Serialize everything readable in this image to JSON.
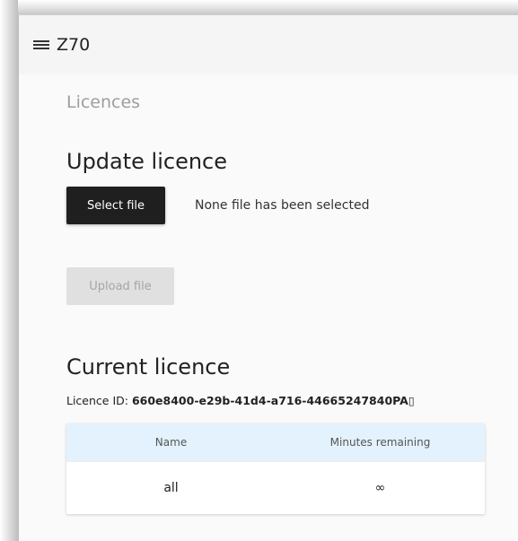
{
  "app": {
    "title": "Z70"
  },
  "page": {
    "title": "Licences"
  },
  "update_section": {
    "heading": "Update licence",
    "select_button_label": "Select file",
    "file_status": "None file has been selected",
    "upload_button_label": "Upload file"
  },
  "current_section": {
    "heading": "Current licence",
    "licence_id_label": "Licence ID: ",
    "licence_id_value": "660e8400-e29b-41d4-a716-44665247840PA▯"
  },
  "table": {
    "columns": [
      "Name",
      "Minutes remaining"
    ],
    "rows": [
      [
        "all",
        "∞"
      ]
    ]
  },
  "colors": {
    "app_bar": "#f5f5f5",
    "primary_button": "#1f1f1f",
    "table_header": "#e3f2fd"
  }
}
